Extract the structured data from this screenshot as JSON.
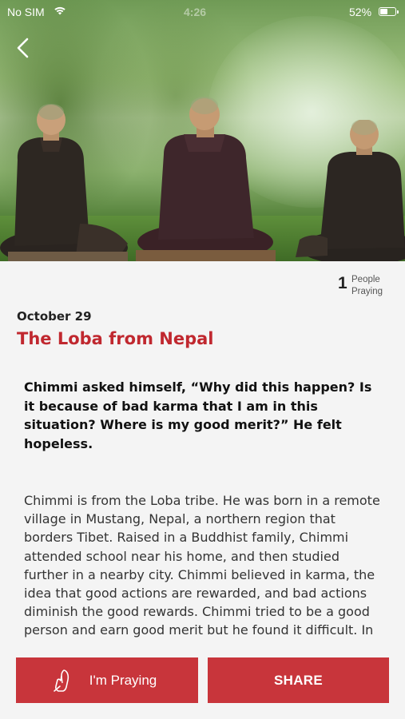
{
  "status_bar": {
    "carrier": "No SIM",
    "time": "4:26",
    "battery_percent": "52%",
    "battery_level": 0.52
  },
  "header": {
    "back_icon": "chevron-left-icon",
    "hero_image": "three-monks-meditating-in-forest"
  },
  "prayer": {
    "count": "1",
    "count_label": "People Praying"
  },
  "article": {
    "date": "October 29",
    "title": "The Loba from Nepal",
    "intro": "Chimmi asked himself, “Why did this happen? Is it because of bad karma that I am in this situation? Where is my good merit?” He felt hopeless.",
    "body": "Chimmi is from the Loba tribe. He was born in a remote village in Mustang, Nepal, a northern region that borders Tibet. Raised in a Buddhist family, Chimmi attended school near his home, and then studied further in a nearby city. Chimmi believed in karma, the idea that good actions are rewarded, and bad actions diminish the good rewards. Chimmi tried to be a good person and earn good merit but he found it difficult. In"
  },
  "actions": {
    "pray_label": "I'm Praying",
    "pray_icon": "praying-hands-icon",
    "share_label": "SHARE"
  },
  "colors": {
    "accent": "#c8353b",
    "title": "#c0282f",
    "background": "#f4f4f4"
  }
}
